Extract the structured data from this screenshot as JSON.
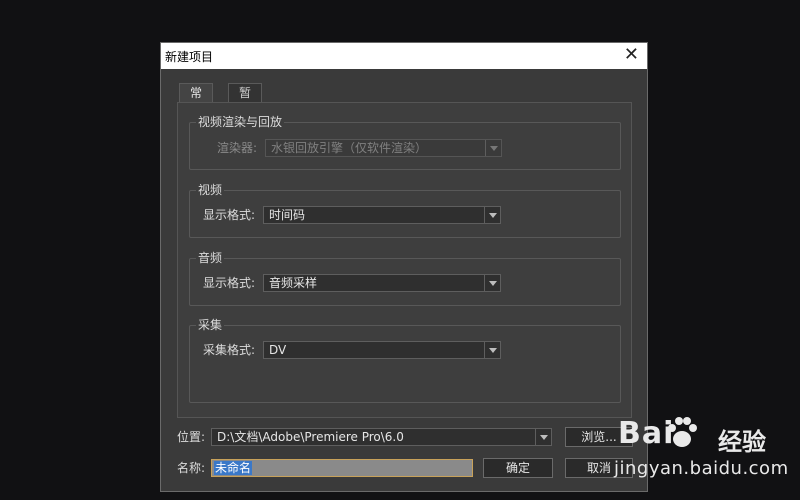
{
  "dialog": {
    "title": "新建项目",
    "close_glyph": "✕"
  },
  "tabs": [
    {
      "label": "常规",
      "active": true
    },
    {
      "label": "暂存盘",
      "active": false
    }
  ],
  "groups": {
    "render": {
      "legend": "视频渲染与回放",
      "label": "渲染器:",
      "value": "水银回放引擎（仅软件渲染）",
      "disabled": true
    },
    "video": {
      "legend": "视频",
      "label": "显示格式:",
      "value": "时间码"
    },
    "audio": {
      "legend": "音频",
      "label": "显示格式:",
      "value": "音频采样"
    },
    "capture": {
      "legend": "采集",
      "label": "采集格式:",
      "value": "DV"
    }
  },
  "location": {
    "label": "位置:",
    "value": "D:\\文档\\Adobe\\Premiere Pro\\6.0",
    "browse_label": "浏览..."
  },
  "name": {
    "label": "名称:",
    "value": "未命名"
  },
  "buttons": {
    "ok": "确定",
    "cancel": "取消"
  },
  "watermark": {
    "brand": "Bai",
    "brand2": "经验",
    "url": "jingyan.baidu.com"
  },
  "colors": {
    "dialog_bg": "#3a3a3a",
    "selection": "#3a78c8",
    "focus_border": "#c8a25a"
  }
}
